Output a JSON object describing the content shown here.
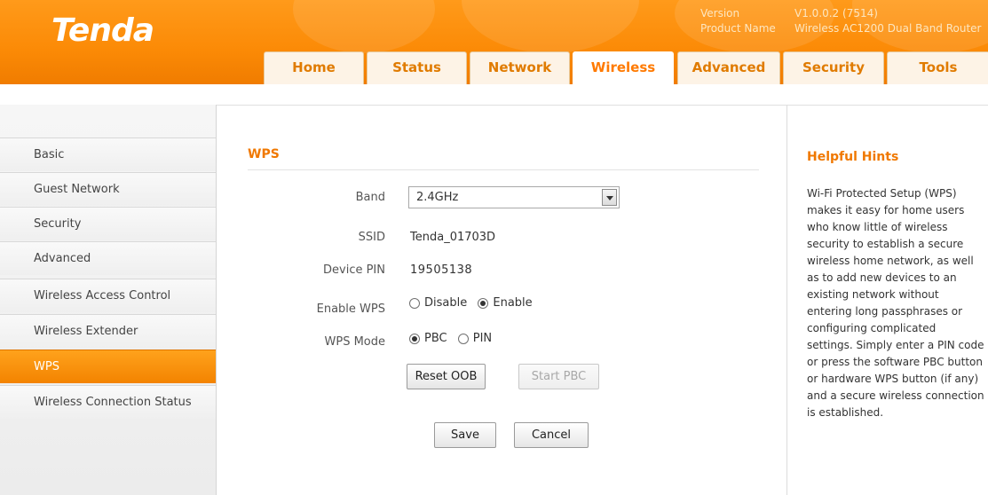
{
  "header": {
    "logo": "Tenda",
    "version_label": "Version",
    "version_value": "V1.0.0.2 (7514)",
    "product_label": "Product Name",
    "product_value": "Wireless AC1200 Dual Band Router"
  },
  "tabs": [
    {
      "label": "Home"
    },
    {
      "label": "Status"
    },
    {
      "label": "Network"
    },
    {
      "label": "Wireless",
      "active": true
    },
    {
      "label": "Advanced"
    },
    {
      "label": "Security"
    },
    {
      "label": "Tools"
    }
  ],
  "sidebar": {
    "items": [
      {
        "label": "Basic"
      },
      {
        "label": "Guest Network"
      },
      {
        "label": "Security"
      },
      {
        "label": "Advanced"
      },
      {
        "label": "Wireless Access Control"
      },
      {
        "label": "Wireless Extender"
      },
      {
        "label": "WPS",
        "active": true
      },
      {
        "label": "Wireless Connection Status"
      }
    ]
  },
  "wps": {
    "title": "WPS",
    "band_label": "Band",
    "band_value": "2.4GHz",
    "ssid_label": "SSID",
    "ssid_value": "Tenda_01703D",
    "pin_label": "Device PIN",
    "pin_value": "19505138",
    "enable_label": "Enable WPS",
    "enable_options": [
      "Disable",
      "Enable"
    ],
    "enable_selected": "Enable",
    "mode_label": "WPS Mode",
    "mode_options": [
      "PBC",
      "PIN"
    ],
    "mode_selected": "PBC",
    "reset_oob_label": "Reset OOB",
    "start_pbc_label": "Start PBC",
    "save_label": "Save",
    "cancel_label": "Cancel"
  },
  "hints": {
    "title": "Helpful Hints",
    "text": "Wi-Fi Protected Setup (WPS) makes it easy for home users who know little of wireless security to establish a secure wireless home network, as well as to add new devices to an existing network without entering long passphrases or configuring complicated settings. Simply enter a PIN code or press the software PBC button or hardware WPS button (if any) and a secure wireless connection is established."
  },
  "colors": {
    "accent": "#f07800",
    "header_orange": "#fb8a06",
    "active_tab_text": "#ff7a00"
  }
}
